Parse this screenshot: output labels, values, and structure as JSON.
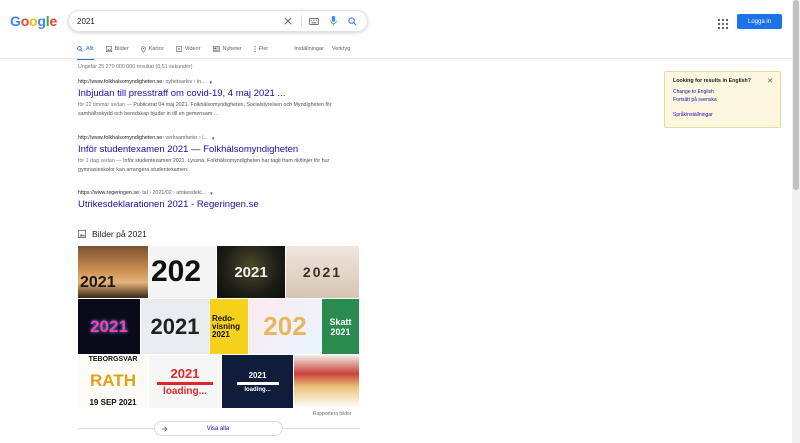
{
  "logo": {
    "letters": [
      "G",
      "o",
      "o",
      "g",
      "l",
      "e"
    ],
    "colors": [
      "#4285f4",
      "#ea4335",
      "#fbbc05",
      "#4285f4",
      "#34a853",
      "#ea4335"
    ]
  },
  "search": {
    "value": "2021"
  },
  "header": {
    "login_label": "Logga in"
  },
  "tabs": [
    {
      "label": "Allt",
      "icon": "search-icon",
      "active": true
    },
    {
      "label": "Bilder",
      "icon": "image-icon"
    },
    {
      "label": "Kartor",
      "icon": "map-pin-icon"
    },
    {
      "label": "Videor",
      "icon": "video-icon"
    },
    {
      "label": "Nyheter",
      "icon": "news-icon"
    },
    {
      "label": "Fler",
      "icon": "more-icon"
    }
  ],
  "tools": {
    "settings": "Inställningar",
    "tools": "Verktyg"
  },
  "stats": "Ungefär 25 270 000 000 resultat (0,51 sekunder)",
  "results": [
    {
      "domain": "http://www.folkhalsomyndigheten.se",
      "path": " › nyhetsarkiv › in...",
      "title": "Inbjudan till presstraff om covid-19, 4 maj 2021 ...",
      "date": "för 22 timmar sedan — ",
      "snippet": "Publicerat 04 maj 2021. Folkhälsomyndigheten, Socialstyrelsen och Myndigheten för samhällsskydd och beredskap bjuder in till en gemensam ..."
    },
    {
      "domain": "http://www.folkhalsomyndigheten.se",
      "path": " › verksamheter › i...",
      "title": "Inför studentexamen 2021 — Folkhälsomyndigheten",
      "date": "för 1 dag sedan — ",
      "snippet": "Inför studentexamen 2021. Lyssna. Folkhälsomyndigheten har tagit fram riktlinjer för hur gymnasieskolor kan arrangera studentexamen."
    },
    {
      "domain": "https://www.regeringen.se",
      "path": " › tal › 2021/02 › utrikesdekl...",
      "title": "Utrikesdeklarationen 2021 - Regeringen.se",
      "date": "",
      "snippet": ""
    }
  ],
  "lang_box": {
    "question": "Looking for results in English?",
    "change": "Change to English",
    "continue": "Fortsätt på svenska",
    "settings": "Språkinställningar"
  },
  "images": {
    "heading": "Bilder på 2021",
    "report": "Rapportera bilder",
    "show_all": "Visa alla",
    "tiles": [
      {
        "text": "2021"
      },
      {
        "text": "202"
      },
      {
        "text": "2021"
      },
      {
        "text": "2021"
      },
      {
        "text": "2021"
      },
      {
        "text": "2021"
      },
      {
        "text": "Redo-visning 2021"
      },
      {
        "text": "202"
      },
      {
        "text": "Skatt 2021"
      },
      {
        "text": "TEBORGSVAR"
      },
      {
        "text": "RATH"
      },
      {
        "text": "19 SEP 2021"
      },
      {
        "text": "2021"
      },
      {
        "text": "loading..."
      },
      {
        "text": "2021"
      },
      {
        "text": "loading..."
      }
    ]
  }
}
